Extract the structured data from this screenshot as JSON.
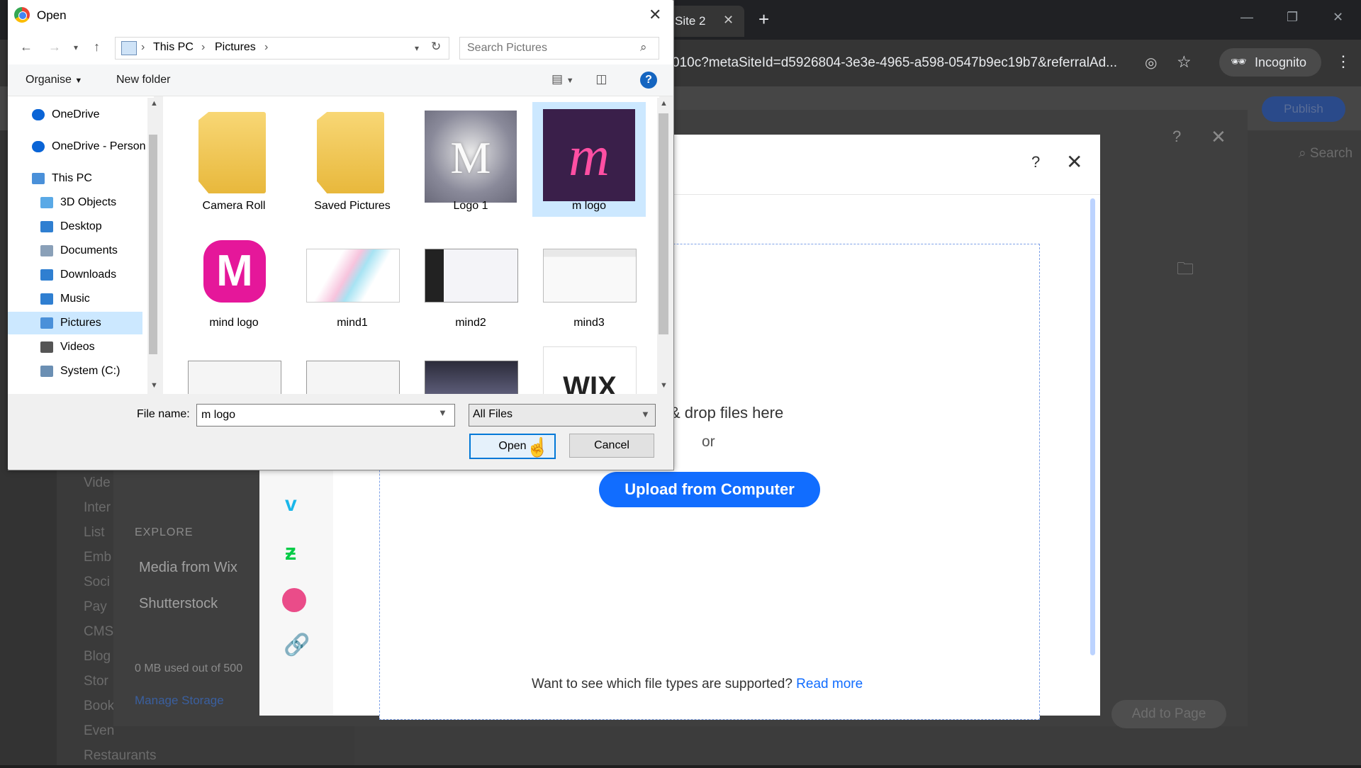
{
  "browser": {
    "tab_title": "Site 2",
    "url": "010c?metaSiteId=d5926804-3e3e-4965-a598-0547b9ec19b7&referralAd...",
    "incognito_label": "Incognito"
  },
  "editor": {
    "publish_label": "Publish",
    "search_label": "Search",
    "explore_heading": "EXPLORE",
    "explore_items": [
      "Media from Wix",
      "Shutterstock"
    ],
    "storage_text": "0 MB used out of 500",
    "manage_storage": "Manage Storage",
    "add_to_page": "Add to Page",
    "left_menu_fragments": [
      "Vide",
      "Inter",
      "List",
      "Emb",
      "Soci",
      "Pay",
      "CMS",
      "Blog",
      "Stor",
      "Book",
      "Even",
      "Restaurants"
    ]
  },
  "upload_modal": {
    "drop_text": "& drop files here",
    "or_text": "or",
    "upload_button": "Upload from Computer",
    "file_types_question": "Want to see which file types are supported?",
    "read_more": "Read more",
    "source_icons": [
      "vimeo-icon",
      "deviantart-icon",
      "dribbble-icon",
      "link-icon"
    ]
  },
  "open_dialog": {
    "title": "Open",
    "breadcrumb": [
      "This PC",
      "Pictures"
    ],
    "search_placeholder": "Search Pictures",
    "organise": "Organise",
    "new_folder": "New folder",
    "nav_items": [
      {
        "label": "OneDrive",
        "icon": "cloud-icon",
        "color": "#0a64d6"
      },
      {
        "label": "OneDrive - Person",
        "icon": "cloud-icon",
        "color": "#0a64d6"
      },
      {
        "label": "This PC",
        "icon": "computer-icon",
        "color": "#4a90d9"
      },
      {
        "label": "3D Objects",
        "icon": "cube-icon",
        "color": "#5aa9e6"
      },
      {
        "label": "Desktop",
        "icon": "desktop-icon",
        "color": "#2f7fd1"
      },
      {
        "label": "Documents",
        "icon": "document-icon",
        "color": "#8aa0b8"
      },
      {
        "label": "Downloads",
        "icon": "download-icon",
        "color": "#2f7fd1"
      },
      {
        "label": "Music",
        "icon": "music-icon",
        "color": "#2f7fd1"
      },
      {
        "label": "Pictures",
        "icon": "pictures-icon",
        "color": "#4a90d9"
      },
      {
        "label": "Videos",
        "icon": "video-icon",
        "color": "#555555"
      },
      {
        "label": "System (C:)",
        "icon": "drive-icon",
        "color": "#6b8fb3"
      }
    ],
    "selected_nav": "Pictures",
    "files": [
      {
        "name": "Camera Roll",
        "kind": "folder"
      },
      {
        "name": "Saved Pictures",
        "kind": "folder"
      },
      {
        "name": "Logo 1",
        "kind": "image"
      },
      {
        "name": "m logo",
        "kind": "image",
        "selected": true
      },
      {
        "name": "mind  logo",
        "kind": "image"
      },
      {
        "name": "mind1",
        "kind": "image"
      },
      {
        "name": "mind2",
        "kind": "image"
      },
      {
        "name": "mind3",
        "kind": "image"
      },
      {
        "name": "",
        "kind": "image"
      },
      {
        "name": "",
        "kind": "image"
      },
      {
        "name": "",
        "kind": "image"
      },
      {
        "name": "WIX",
        "kind": "image"
      }
    ],
    "file_name_label": "File name:",
    "file_name_value": "m logo",
    "file_type": "All Files",
    "open_button": "Open",
    "cancel_button": "Cancel"
  }
}
